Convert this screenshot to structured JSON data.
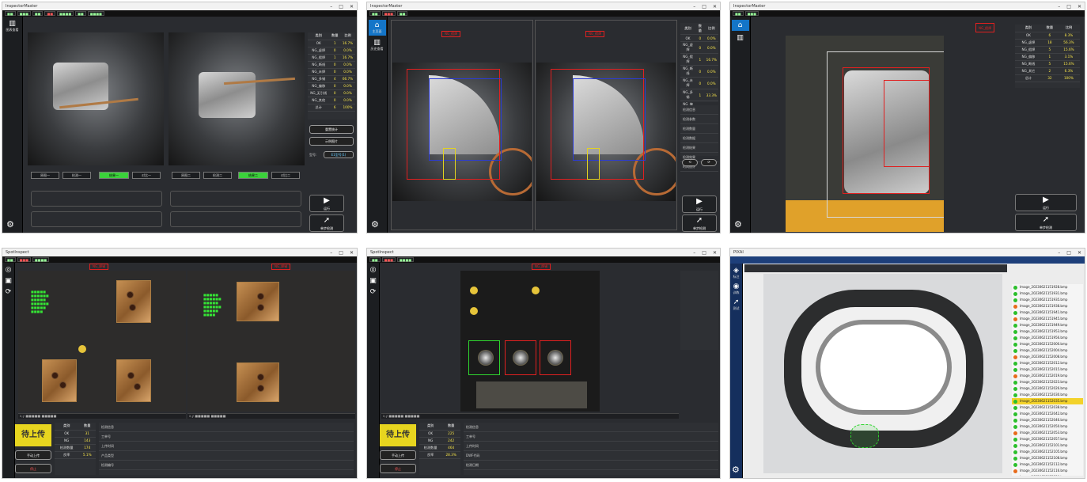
{
  "panel1": {
    "title": "InspectorMaster",
    "nav": [
      {
        "label": "图表查看"
      },
      {
        "label": "设置"
      }
    ],
    "stats": {
      "headers": [
        "类别",
        "数量",
        "比例"
      ],
      "rows": [
        [
          "OK",
          "1",
          "16.7%"
        ],
        [
          "NG_虚焊",
          "0",
          "0.0%"
        ],
        [
          "NG_假焊",
          "1",
          "16.7%"
        ],
        [
          "NG_断线",
          "0",
          "0.0%"
        ],
        [
          "NG_未焊",
          "0",
          "0.0%"
        ],
        [
          "NG_多锡",
          "4",
          "66.7%"
        ],
        [
          "NG_偏移",
          "0",
          "0.0%"
        ],
        [
          "NG_无引线",
          "0",
          "0.0%"
        ],
        [
          "NG_其他",
          "0",
          "0.0%"
        ],
        [
          "总计",
          "6",
          "100%"
        ]
      ]
    },
    "side_buttons": [
      "重置统计",
      "示例图片"
    ],
    "model_label": "型号:",
    "model_value": "E1型号(1)",
    "segments_left": [
      "原图一",
      "检测一",
      "结果一",
      "对比一"
    ],
    "segments_right": [
      "原图二",
      "检测二",
      "结果二",
      "对比二"
    ],
    "run_button": "运行",
    "stop_button": "单步检测"
  },
  "panel2": {
    "title": "InspectorMaster",
    "nav": [
      {
        "label": "主页面"
      },
      {
        "label": "历史查看"
      },
      {
        "label": "设置"
      }
    ],
    "tags": [
      "NG_假焊",
      "NG_假焊"
    ],
    "stats": {
      "headers": [
        "类别",
        "数量",
        "比例"
      ],
      "rows": [
        [
          "OK",
          "0",
          "0.0%"
        ],
        [
          "NG_虚焊",
          "0",
          "0.0%"
        ],
        [
          "NG_假焊",
          "1",
          "16.7%"
        ],
        [
          "NG_断线",
          "0",
          "0.0%"
        ],
        [
          "NG_未焊",
          "0",
          "0.0%"
        ],
        [
          "NG_多锡",
          "1",
          "33.3%"
        ],
        [
          "NG_偏移",
          "0",
          "0.0%"
        ],
        [
          "NG_其它",
          "0",
          "0.0%"
        ],
        [
          "总计",
          "10",
          "100%"
        ]
      ]
    },
    "detail_rows": [
      "检测信息",
      "检测参数",
      "检测数量",
      "检测数据",
      "检测结果",
      "检测效果",
      "时间统计"
    ],
    "run_button": "运行",
    "stop_button": "单步检测"
  },
  "panel3": {
    "title": "InspectorMaster",
    "tag": "NG_假焊",
    "stats": {
      "headers": [
        "类别",
        "数量",
        "比例"
      ],
      "rows": [
        [
          "OK",
          "6",
          "8.3%"
        ],
        [
          "NG_虚焊",
          "18",
          "56.3%"
        ],
        [
          "NG_假焊",
          "5",
          "15.6%"
        ],
        [
          "NG_偏移",
          "1",
          "3.1%"
        ],
        [
          "NG_断线",
          "5",
          "15.6%"
        ],
        [
          "NG_其它",
          "2",
          "6.3%"
        ],
        [
          "总计",
          "32",
          "100%"
        ]
      ]
    },
    "run_button": "运行",
    "stop_button": "单步检测"
  },
  "panel4": {
    "title": "SpotInspect",
    "tags": [
      "NG_焊锡",
      "NG_焊锡"
    ],
    "upload_label": "待上传",
    "summary_headers": [
      "类别",
      "数量"
    ],
    "summary_rows": [
      [
        "OK",
        "31"
      ],
      [
        "NG",
        "143"
      ],
      [
        "检测数量",
        "174"
      ],
      [
        "良率",
        "5.1%"
      ]
    ],
    "info_labels": [
      "检测信息",
      "工单号",
      "上传时间",
      "产品类型",
      "检测编号"
    ],
    "btn_upload": "手动上传",
    "btn_stop": "停止"
  },
  "panel5": {
    "title": "SpotInspect",
    "tag": "NG_焊锡",
    "upload_label": "待上传",
    "summary_headers": [
      "类别",
      "数量"
    ],
    "summary_rows": [
      [
        "OK",
        "225"
      ],
      [
        "NG",
        "242"
      ],
      [
        "检测数量",
        "464"
      ],
      [
        "良率",
        "28.3%"
      ]
    ],
    "info_labels": [
      "检测信息",
      "工单号",
      "上传时间",
      "DWF代码",
      "检测日期"
    ],
    "btn_upload": "手动上传",
    "btn_stop": "停止"
  },
  "panel6": {
    "title": "PIXAI",
    "nav": [
      {
        "label": "标注"
      },
      {
        "label": "训练"
      },
      {
        "label": "测试"
      },
      {
        "label": "设置"
      }
    ],
    "files": [
      "Image_20230621151928.bmp",
      "Image_20230621151931.bmp",
      "Image_20230621151935.bmp",
      "Image_20230621151938.bmp",
      "Image_20230621151941.bmp",
      "Image_20230621151945.bmp",
      "Image_20230621151949.bmp",
      "Image_20230621151953.bmp",
      "Image_20230621151956.bmp",
      "Image_20230621152000.bmp",
      "Image_20230621152004.bmp",
      "Image_20230621152008.bmp",
      "Image_20230621152012.bmp",
      "Image_20230621152015.bmp",
      "Image_20230621152019.bmp",
      "Image_20230621152023.bmp",
      "Image_20230621152026.bmp",
      "Image_20230621152030.bmp",
      "Image_20230621152035.bmp",
      "Image_20230621152038.bmp",
      "Image_20230621152042.bmp",
      "Image_20230621152046.bmp",
      "Image_20230621152050.bmp",
      "Image_20230621152053.bmp",
      "Image_20230621152057.bmp",
      "Image_20230621152101.bmp",
      "Image_20230621152105.bmp",
      "Image_20230621152108.bmp",
      "Image_20230621152112.bmp",
      "Image_20230621152116.bmp",
      "Image_20230621152120.bmp",
      "Image_20230621152124.bmp"
    ],
    "file_status": [
      "ok",
      "ok",
      "ok",
      "ng",
      "ok",
      "ng",
      "ok",
      "ok",
      "ok",
      "ok",
      "ok",
      "ng",
      "ok",
      "ok",
      "ng",
      "ok",
      "ok",
      "ok",
      "sel",
      "ok",
      "ok",
      "ok",
      "ok",
      "ng",
      "ok",
      "ok",
      "ok",
      "ok",
      "ok",
      "ng",
      "ok",
      "ok"
    ],
    "status_colors": {
      "ok": "#2bbf2b",
      "ng": "#e86a1a"
    }
  }
}
